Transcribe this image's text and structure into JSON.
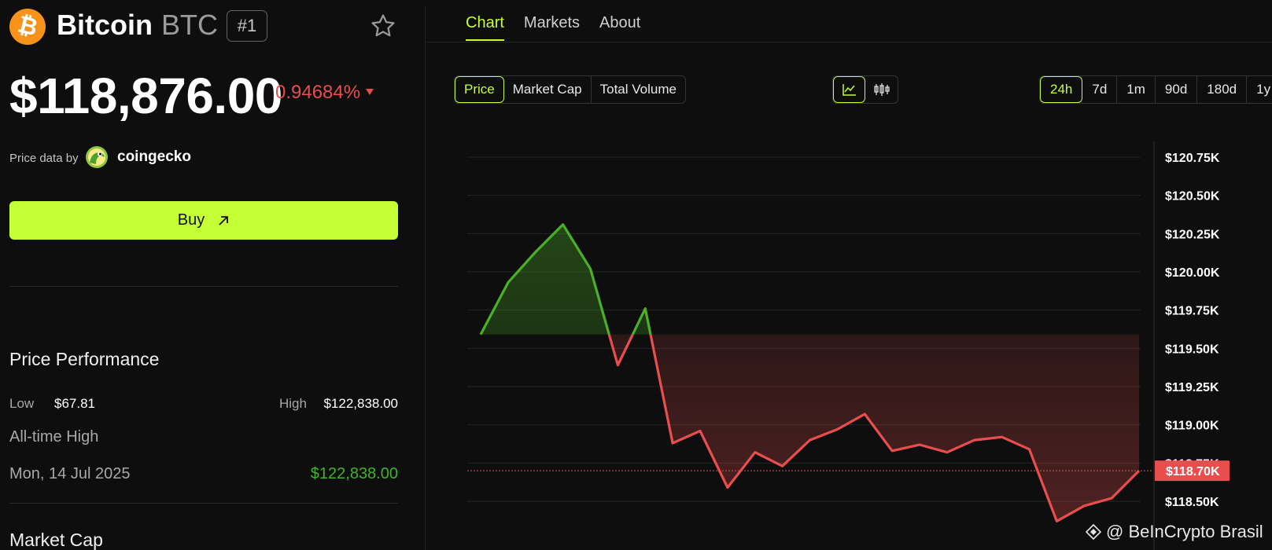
{
  "coin": {
    "name": "Bitcoin",
    "symbol": "BTC",
    "rank": "#1",
    "logo_glyph": "₿",
    "logo_color": "#f7931a"
  },
  "price": {
    "value": "$118,876.00",
    "change": "0.94684%",
    "change_direction": "down",
    "change_color": "#e84e4e"
  },
  "source": {
    "label": "Price data by",
    "provider": "coingecko"
  },
  "buy": {
    "label": "Buy",
    "color": "#c5ff36"
  },
  "performance": {
    "title": "Price Performance",
    "low_label": "Low",
    "low_value": "$67.81",
    "high_label": "High",
    "high_value": "$122,838.00",
    "ath_label": "All-time High",
    "ath_date": "Mon, 14 Jul 2025",
    "ath_value": "$122,838.00"
  },
  "market_cap": {
    "title": "Market Cap"
  },
  "tabs": [
    {
      "label": "Chart",
      "active": true
    },
    {
      "label": "Markets",
      "active": false
    },
    {
      "label": "About",
      "active": false
    }
  ],
  "metric_buttons": [
    {
      "label": "Price",
      "active": true
    },
    {
      "label": "Market Cap",
      "active": false
    },
    {
      "label": "Total Volume",
      "active": false
    }
  ],
  "chart_type_buttons": [
    {
      "icon": "line-chart-icon",
      "active": true
    },
    {
      "icon": "candlestick-icon",
      "active": false
    }
  ],
  "range_buttons": [
    {
      "label": "24h",
      "active": true
    },
    {
      "label": "7d",
      "active": false
    },
    {
      "label": "1m",
      "active": false
    },
    {
      "label": "90d",
      "active": false
    },
    {
      "label": "180d",
      "active": false
    },
    {
      "label": "1y",
      "active": false
    }
  ],
  "chart_data": {
    "type": "line",
    "baseline": 119.59,
    "current_label": "$118.70K",
    "current_value": 118.7,
    "up_color": "#4caf28",
    "down_color": "#e84e4e",
    "ylim": [
      118.5,
      120.75
    ],
    "y_ticks": [
      {
        "value": 120.75,
        "label": "$120.75K"
      },
      {
        "value": 120.5,
        "label": "$120.50K"
      },
      {
        "value": 120.25,
        "label": "$120.25K"
      },
      {
        "value": 120.0,
        "label": "$120.00K"
      },
      {
        "value": 119.75,
        "label": "$119.75K"
      },
      {
        "value": 119.5,
        "label": "$119.50K"
      },
      {
        "value": 119.25,
        "label": "$119.25K"
      },
      {
        "value": 119.0,
        "label": "$119.00K"
      },
      {
        "value": 118.75,
        "label": "$118.75K"
      },
      {
        "value": 118.5,
        "label": "$118.50K"
      }
    ],
    "values": [
      119.59,
      119.93,
      120.13,
      120.31,
      120.02,
      119.39,
      119.76,
      118.88,
      118.96,
      118.59,
      118.82,
      118.73,
      118.9,
      118.97,
      119.07,
      118.83,
      118.87,
      118.82,
      118.9,
      118.92,
      118.84,
      118.37,
      118.47,
      118.52,
      118.7
    ]
  },
  "watermark": {
    "text": "@ BeInCrypto Brasil"
  }
}
